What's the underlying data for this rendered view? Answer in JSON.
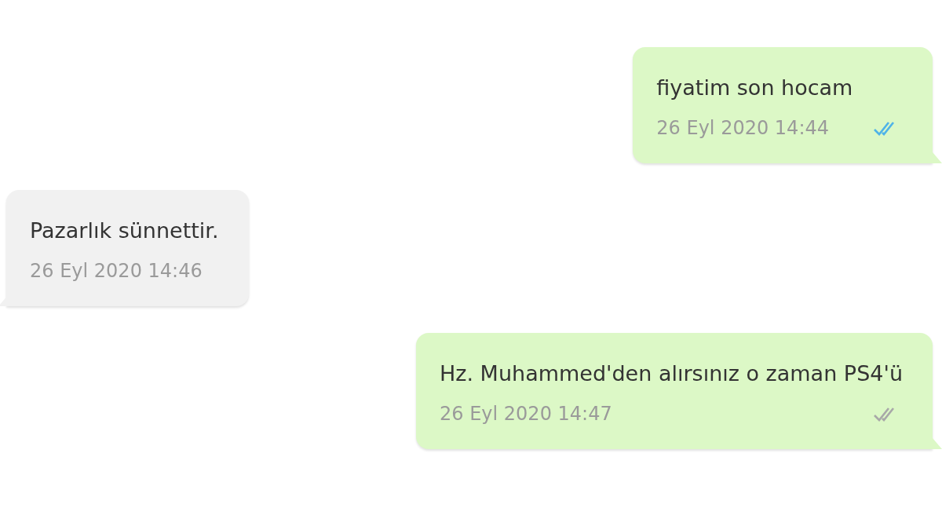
{
  "messages": [
    {
      "kind": "outgoing",
      "text": "fiyatim son hocam",
      "time": "26 Eyl 2020 14:44",
      "read": true
    },
    {
      "kind": "incoming",
      "text": "Pazarlık sünnettir.",
      "time": "26 Eyl 2020 14:46"
    },
    {
      "kind": "outgoing",
      "text": "Hz. Muhammed'den alırsınız o zaman PS4'ü",
      "time": "26 Eyl 2020 14:47",
      "read": false
    }
  ]
}
